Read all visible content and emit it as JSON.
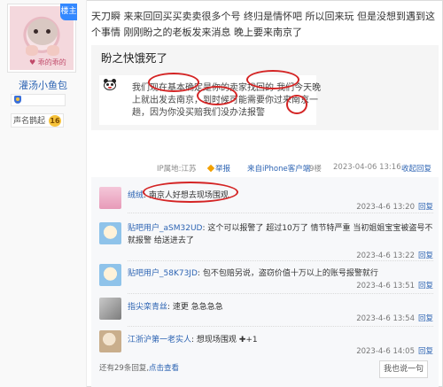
{
  "author": {
    "badge": "楼主",
    "avatar_tag": "♥ 乖的乖的",
    "name": "灌汤小鱼包",
    "age_label": "吧龄",
    "age_prefix": "声名鹊起",
    "age_value": "16"
  },
  "post": {
    "body": "天刀瞬 来来回回买买卖卖很多个号 终归是情怀吧 所以回来玩 但是没想到遇到这个事情 刚刚盼之的老板发来消息 晚上要来南京了",
    "quote": {
      "title": "盼之快饿死了",
      "message": "我们现在基本确定是你的卖家找回的 我们今天晚上就出发去南京，到时候可能需要你过来南京一趟，因为你没买赔我们没办法报警"
    },
    "tail": {
      "ip": "IP属地:江苏",
      "report": "举报",
      "client": "来自iPhone客户端",
      "floor": "9楼",
      "time": "2023-04-06 13:16",
      "collapse": "收起回复"
    }
  },
  "replies": [
    {
      "user": "绒绒",
      "text": "南京人好想去现场围观",
      "time": "2023-4-6 13:20",
      "action": "回复"
    },
    {
      "user": "贴吧用户_aSM32UD",
      "text": "这个可以报警了 超过10万了 情节特严重 当初姐姐宝宝被盗号不就报警 给送进去了",
      "time": "2023-4-6 13:22",
      "action": "回复"
    },
    {
      "user": "贴吧用户_58K73JD",
      "text": "包不包赔另说，盗窃价值十万以上的账号报警就行",
      "time": "2023-4-6 13:51",
      "action": "回复"
    },
    {
      "user": "指尖栾青丝",
      "text": "速更 急急急急",
      "time": "2023-4-6 13:54",
      "action": "回复"
    },
    {
      "user": "江浙沪第一老实人",
      "text": "想现场围观",
      "time": "2023-4-6 14:05",
      "action": "回复"
    }
  ],
  "footer": {
    "count": "还有29条回复,",
    "link": "点击查看",
    "me_too": "我也说一句"
  },
  "icons": {
    "report": "report-icon",
    "lz_badge": "lz-badge",
    "panda": "panda-emoticon-icon",
    "plus": "plus-emoji-icon"
  },
  "colors": {
    "link": "#2d64b3",
    "highlight_ring": "#d42424",
    "badge_blue": "#3388ff"
  }
}
